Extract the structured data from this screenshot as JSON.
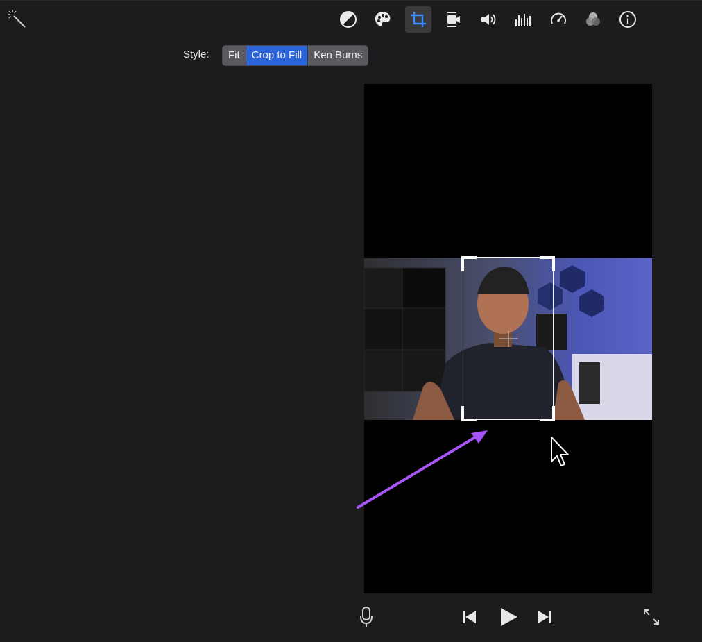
{
  "toolbar": {
    "magic_wand_icon": "magic-wand-icon",
    "tools": [
      {
        "icon": "color-balance-icon"
      },
      {
        "icon": "color-palette-icon"
      },
      {
        "icon": "crop-icon",
        "active": true
      },
      {
        "icon": "stabilization-camera-icon"
      },
      {
        "icon": "volume-icon"
      },
      {
        "icon": "equalizer-icon"
      },
      {
        "icon": "speed-icon"
      },
      {
        "icon": "filter-icon"
      },
      {
        "icon": "info-icon"
      }
    ]
  },
  "style": {
    "label": "Style:",
    "options": [
      "Fit",
      "Crop to Fill",
      "Ken Burns"
    ],
    "selected": "Crop to Fill"
  },
  "playback": {
    "mic_icon": "microphone-icon",
    "prev_icon": "skip-back-icon",
    "play_icon": "play-icon",
    "next_icon": "skip-forward-icon",
    "fullscreen_icon": "fullscreen-icon"
  },
  "colors": {
    "accent": "#2b63d9",
    "annotation_arrow": "#a855f7",
    "background": "#1c1c1e"
  }
}
